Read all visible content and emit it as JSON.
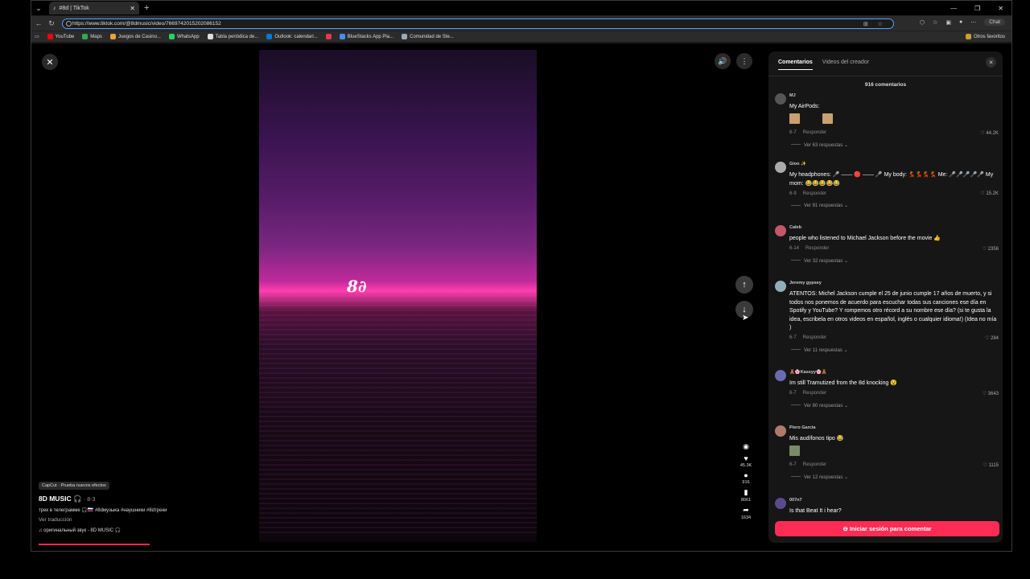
{
  "browser": {
    "tab_title": "#8d | TikTok",
    "url": "https://www.tiktok.com/@8dmusic/video/7669742015202086152",
    "chat_label": "Chat",
    "bookmarks": [
      "YouTube",
      "Maps",
      "Juegos de Casino...",
      "WhatsApp",
      "Tabla periódica de...",
      "Outlook: calendari...",
      "BlueStacks App Pla...",
      "Comunidad de Ste..."
    ],
    "other_bookmarks": "Otros favoritos"
  },
  "video": {
    "logo_text": "8∂",
    "capcut_label": "CapCut · Prueba nuevos efectos",
    "author": "8D MUSIC 🎧",
    "date": "· 8-3",
    "description": "трек в телеграмме 🎧🇷🇺 #8dмузыка #наушники #8dтреки",
    "translate": "Ver traducción",
    "sound": "♫ оригинальный звук - 8D MUSIC 🎧",
    "progress": 0.4
  },
  "actions": {
    "likes": "45.3K",
    "comments": "916",
    "saves": "8061",
    "shares": "1634"
  },
  "comments_panel": {
    "tab_comments": "Comentarios",
    "tab_creator": "Videos del creador",
    "count": "916 comentarios",
    "login_button": "Iniciar sesión para comentar",
    "items": [
      {
        "user": "MJ",
        "text": "My AirPods:",
        "date": "6-7",
        "reply": "Responder",
        "likes": "44.2K",
        "more": "Ver 63 respuestas ⌄"
      },
      {
        "user": "Gioo ✨",
        "text": "My headphones: 🎤 —— 🔴 —— 🎤 My body: 💃💃💃💃 Me: 🎤🎤🎤🎤🎤 My mom: 😂😂😂😂😂",
        "date": "6-9",
        "reply": "Responder",
        "likes": "15.2K",
        "more": "Ver 81 respuestas ⌄"
      },
      {
        "user": "Caleb",
        "text": "people who listened to Michael Jackson before the movie 👍",
        "date": "6-14",
        "reply": "Responder",
        "likes": "2356",
        "more": "Ver 32 respuestas ⌄"
      },
      {
        "user": "Jeremy gypsey",
        "text": "ATENTOS: Michel Jackson cumple el 25 de junio cumple 17 años de muerto, y si todos nos ponemos de acuerdo para escuchar todas sus canciones ese día en Spotify y YouTube? Y rompemos otro récord a su nombre ese día? (si te gusta la idea, escribela en otros videos en español, inglés o cualquier idioma!) (Idea no mía )",
        "date": "6-7",
        "reply": "Responder",
        "likes": "284",
        "more": "Ver 11 respuestas ⌄"
      },
      {
        "user": "🧸🌸Kassyy🌸🧸",
        "text": "Im still Tramutized from the 8d knocking 😵",
        "date": "6-7",
        "reply": "Responder",
        "likes": "3643",
        "more": "Ver 80 respuestas ⌄"
      },
      {
        "user": "Piero Garcia",
        "text": "Mis audífonos tipo 😂",
        "date": "6-7",
        "reply": "Responder",
        "likes": "1115",
        "more": "Ver 12 respuestas ⌄"
      },
      {
        "user": "007n7",
        "text": "Is that Beat It i hear?"
      }
    ]
  }
}
